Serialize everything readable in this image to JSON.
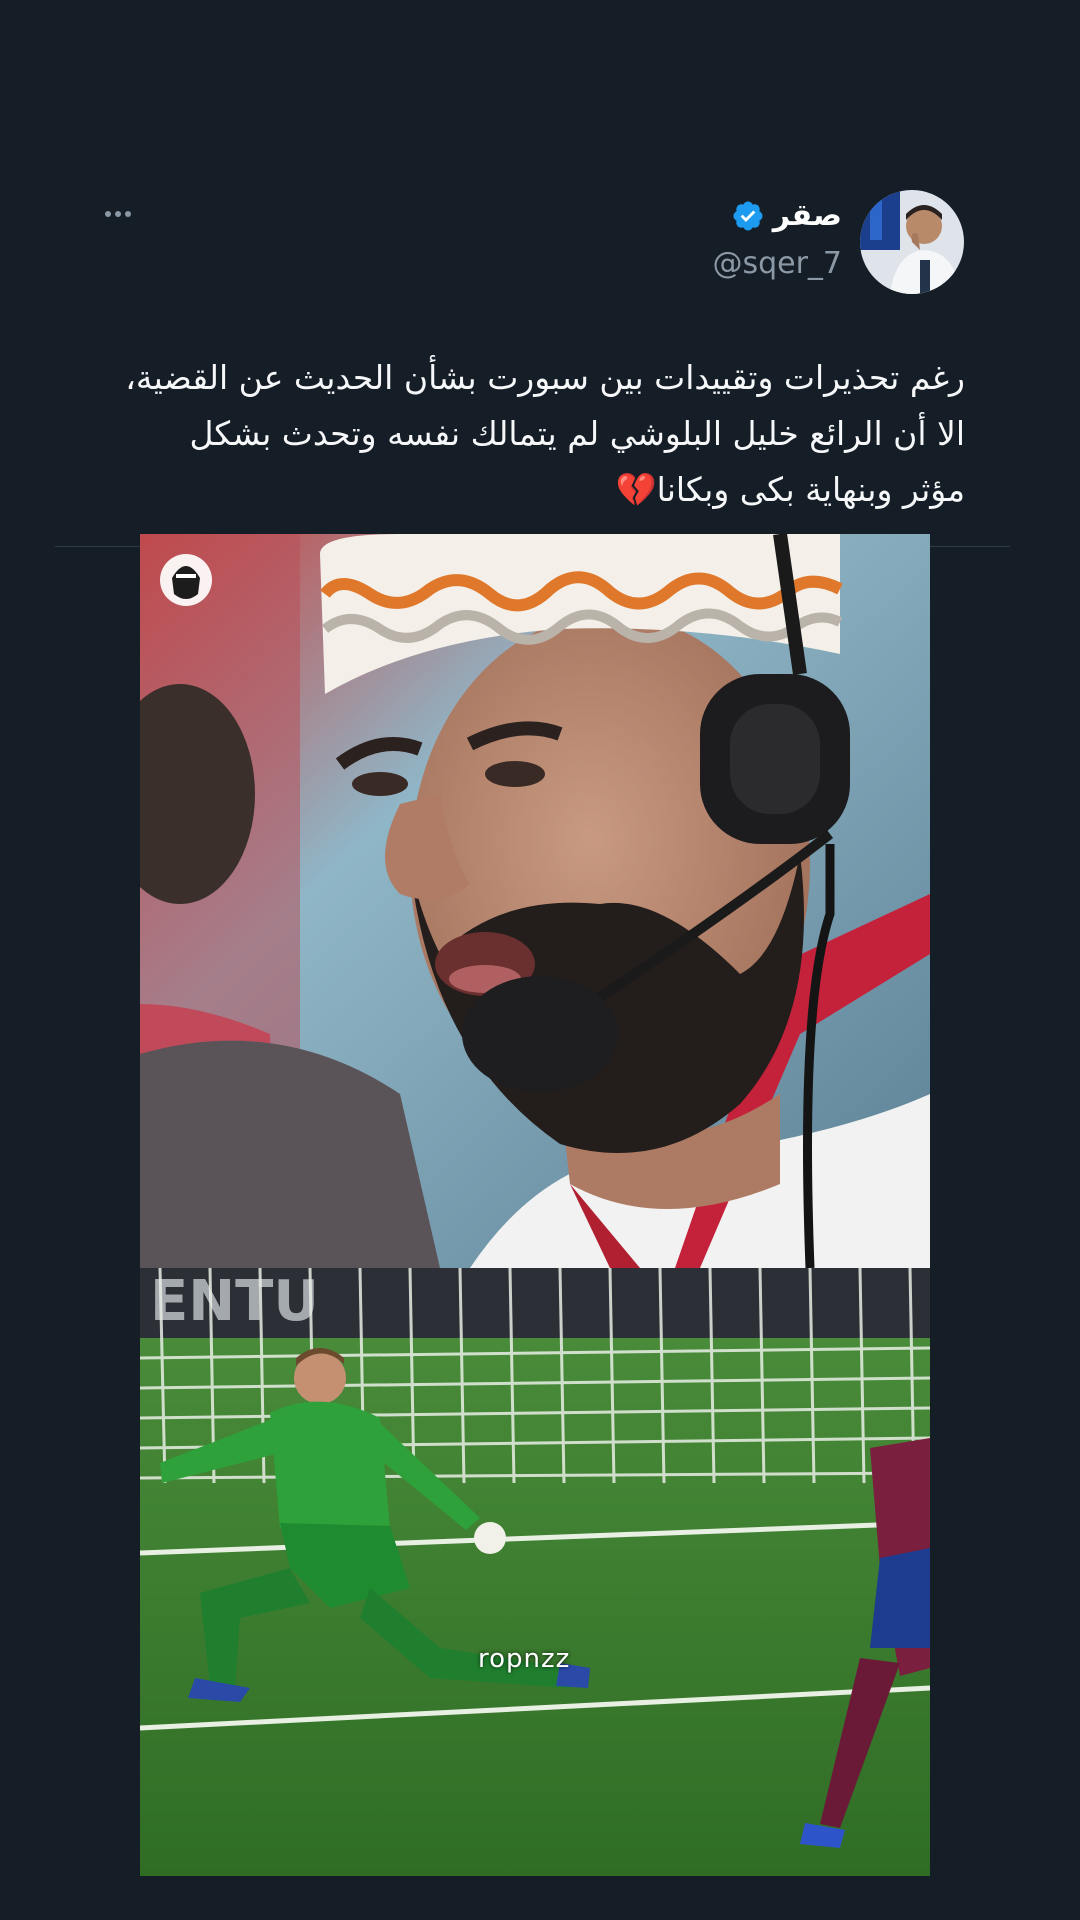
{
  "tweet": {
    "display_name": "صقر",
    "handle": "@sqer_7",
    "text": "رغم تحذيرات وتقييدات بين سبورت بشأن الحديث عن القضية، الا أن الرائع خليل البلوشي لم يتمالك نفسه وتحدث بشكل مؤثر وبنهاية بكى وبكانا💔",
    "verified": true
  },
  "media": {
    "watermark": "ropnzz"
  },
  "icons": {
    "more": "more-horizontal-icon",
    "verified": "verified-badge-icon"
  },
  "colors": {
    "background": "#151d26",
    "verified": "#1d9bf0",
    "handle": "#8b98a5"
  }
}
